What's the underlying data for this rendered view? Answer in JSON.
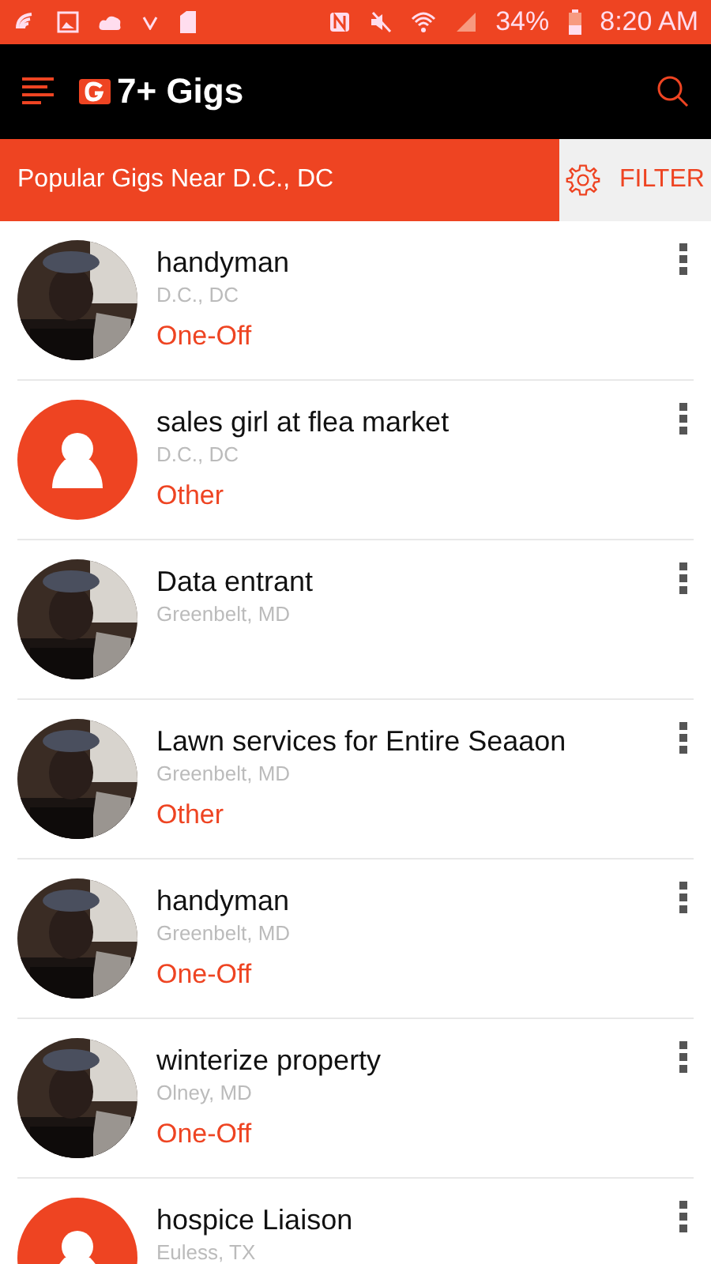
{
  "status_bar": {
    "battery": "34%",
    "time": "8:20 AM"
  },
  "app_bar": {
    "title": "7+ Gigs"
  },
  "location_bar": {
    "title": "Popular Gigs Near D.C., DC",
    "filter": "FILTER"
  },
  "gigs": [
    {
      "kind": "picture",
      "title": "handyman",
      "location": "D.C., DC",
      "category": "One-Off"
    },
    {
      "kind": "placeholder",
      "title": "sales girl at flea market",
      "location": "D.C., DC",
      "category": "Other"
    },
    {
      "kind": "picture",
      "title": "Data entrant",
      "location": "Greenbelt, MD"
    },
    {
      "kind": "picture",
      "title": "Lawn services for Entire Seaaon",
      "location": "Greenbelt, MD",
      "category": "Other"
    },
    {
      "kind": "picture",
      "title": "handyman",
      "location": "Greenbelt, MD",
      "category": "One-Off"
    },
    {
      "kind": "picture",
      "title": "winterize property",
      "location": "Olney, MD",
      "category": "One-Off"
    },
    {
      "kind": "placeholder",
      "title": "hospice Liaison",
      "location": "Euless, TX"
    }
  ]
}
